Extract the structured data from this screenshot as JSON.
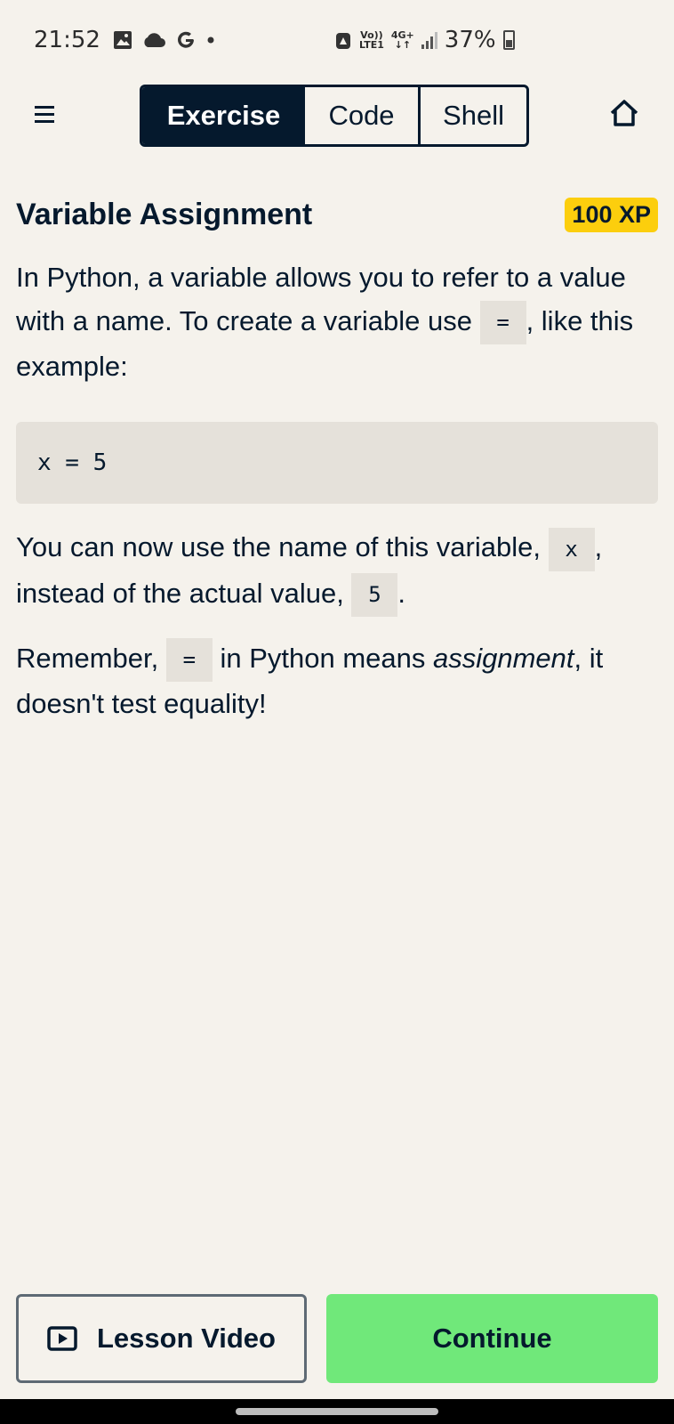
{
  "status_bar": {
    "time": "21:52",
    "volte": "Vo))",
    "lte": "LTE1",
    "network": "4G+",
    "battery_percent": "37%"
  },
  "nav": {
    "tabs": [
      "Exercise",
      "Code",
      "Shell"
    ],
    "active_tab": "Exercise"
  },
  "exercise": {
    "title": "Variable Assignment",
    "xp": "100 XP",
    "intro_part1": "In Python, a variable allows you to refer to a value with a name. To create a variable use ",
    "intro_code": "=",
    "intro_part2": ", like this example:",
    "code_block": "x = 5",
    "p2_part1": "You can now use the name of this variable, ",
    "p2_code1": "x",
    "p2_part2": ", instead of the actual value, ",
    "p2_code2": "5",
    "p2_part3": ".",
    "p3_part1": "Remember, ",
    "p3_code": "=",
    "p3_part2": " in Python means ",
    "p3_em": "assignment",
    "p3_part3": ", it doesn't test equality!"
  },
  "buttons": {
    "lesson_video": "Lesson Video",
    "continue": "Continue"
  },
  "colors": {
    "background": "#f5f2ec",
    "navy": "#05192d",
    "xp_badge": "#fcce0d",
    "continue": "#70e87a",
    "code_bg": "#e5e1da"
  },
  "icons": {
    "menu": "hamburger-icon",
    "home": "home-icon",
    "video": "play-video-icon"
  }
}
